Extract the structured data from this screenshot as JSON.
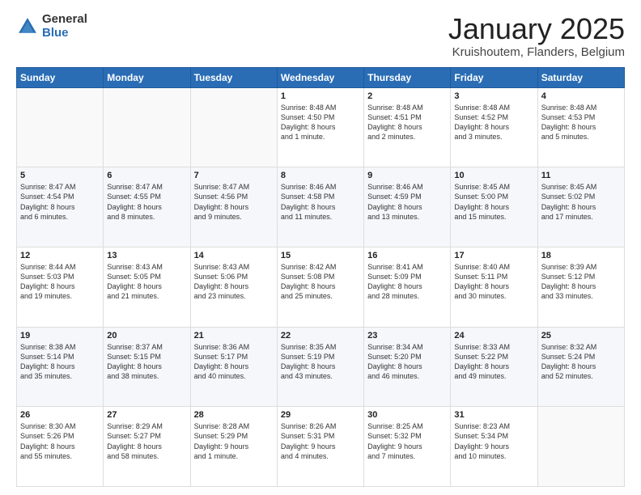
{
  "logo": {
    "general": "General",
    "blue": "Blue"
  },
  "title": {
    "month": "January 2025",
    "location": "Kruishoutem, Flanders, Belgium"
  },
  "weekdays": [
    "Sunday",
    "Monday",
    "Tuesday",
    "Wednesday",
    "Thursday",
    "Friday",
    "Saturday"
  ],
  "weeks": [
    [
      {
        "day": "",
        "info": ""
      },
      {
        "day": "",
        "info": ""
      },
      {
        "day": "",
        "info": ""
      },
      {
        "day": "1",
        "info": "Sunrise: 8:48 AM\nSunset: 4:50 PM\nDaylight: 8 hours\nand 1 minute."
      },
      {
        "day": "2",
        "info": "Sunrise: 8:48 AM\nSunset: 4:51 PM\nDaylight: 8 hours\nand 2 minutes."
      },
      {
        "day": "3",
        "info": "Sunrise: 8:48 AM\nSunset: 4:52 PM\nDaylight: 8 hours\nand 3 minutes."
      },
      {
        "day": "4",
        "info": "Sunrise: 8:48 AM\nSunset: 4:53 PM\nDaylight: 8 hours\nand 5 minutes."
      }
    ],
    [
      {
        "day": "5",
        "info": "Sunrise: 8:47 AM\nSunset: 4:54 PM\nDaylight: 8 hours\nand 6 minutes."
      },
      {
        "day": "6",
        "info": "Sunrise: 8:47 AM\nSunset: 4:55 PM\nDaylight: 8 hours\nand 8 minutes."
      },
      {
        "day": "7",
        "info": "Sunrise: 8:47 AM\nSunset: 4:56 PM\nDaylight: 8 hours\nand 9 minutes."
      },
      {
        "day": "8",
        "info": "Sunrise: 8:46 AM\nSunset: 4:58 PM\nDaylight: 8 hours\nand 11 minutes."
      },
      {
        "day": "9",
        "info": "Sunrise: 8:46 AM\nSunset: 4:59 PM\nDaylight: 8 hours\nand 13 minutes."
      },
      {
        "day": "10",
        "info": "Sunrise: 8:45 AM\nSunset: 5:00 PM\nDaylight: 8 hours\nand 15 minutes."
      },
      {
        "day": "11",
        "info": "Sunrise: 8:45 AM\nSunset: 5:02 PM\nDaylight: 8 hours\nand 17 minutes."
      }
    ],
    [
      {
        "day": "12",
        "info": "Sunrise: 8:44 AM\nSunset: 5:03 PM\nDaylight: 8 hours\nand 19 minutes."
      },
      {
        "day": "13",
        "info": "Sunrise: 8:43 AM\nSunset: 5:05 PM\nDaylight: 8 hours\nand 21 minutes."
      },
      {
        "day": "14",
        "info": "Sunrise: 8:43 AM\nSunset: 5:06 PM\nDaylight: 8 hours\nand 23 minutes."
      },
      {
        "day": "15",
        "info": "Sunrise: 8:42 AM\nSunset: 5:08 PM\nDaylight: 8 hours\nand 25 minutes."
      },
      {
        "day": "16",
        "info": "Sunrise: 8:41 AM\nSunset: 5:09 PM\nDaylight: 8 hours\nand 28 minutes."
      },
      {
        "day": "17",
        "info": "Sunrise: 8:40 AM\nSunset: 5:11 PM\nDaylight: 8 hours\nand 30 minutes."
      },
      {
        "day": "18",
        "info": "Sunrise: 8:39 AM\nSunset: 5:12 PM\nDaylight: 8 hours\nand 33 minutes."
      }
    ],
    [
      {
        "day": "19",
        "info": "Sunrise: 8:38 AM\nSunset: 5:14 PM\nDaylight: 8 hours\nand 35 minutes."
      },
      {
        "day": "20",
        "info": "Sunrise: 8:37 AM\nSunset: 5:15 PM\nDaylight: 8 hours\nand 38 minutes."
      },
      {
        "day": "21",
        "info": "Sunrise: 8:36 AM\nSunset: 5:17 PM\nDaylight: 8 hours\nand 40 minutes."
      },
      {
        "day": "22",
        "info": "Sunrise: 8:35 AM\nSunset: 5:19 PM\nDaylight: 8 hours\nand 43 minutes."
      },
      {
        "day": "23",
        "info": "Sunrise: 8:34 AM\nSunset: 5:20 PM\nDaylight: 8 hours\nand 46 minutes."
      },
      {
        "day": "24",
        "info": "Sunrise: 8:33 AM\nSunset: 5:22 PM\nDaylight: 8 hours\nand 49 minutes."
      },
      {
        "day": "25",
        "info": "Sunrise: 8:32 AM\nSunset: 5:24 PM\nDaylight: 8 hours\nand 52 minutes."
      }
    ],
    [
      {
        "day": "26",
        "info": "Sunrise: 8:30 AM\nSunset: 5:26 PM\nDaylight: 8 hours\nand 55 minutes."
      },
      {
        "day": "27",
        "info": "Sunrise: 8:29 AM\nSunset: 5:27 PM\nDaylight: 8 hours\nand 58 minutes."
      },
      {
        "day": "28",
        "info": "Sunrise: 8:28 AM\nSunset: 5:29 PM\nDaylight: 9 hours\nand 1 minute."
      },
      {
        "day": "29",
        "info": "Sunrise: 8:26 AM\nSunset: 5:31 PM\nDaylight: 9 hours\nand 4 minutes."
      },
      {
        "day": "30",
        "info": "Sunrise: 8:25 AM\nSunset: 5:32 PM\nDaylight: 9 hours\nand 7 minutes."
      },
      {
        "day": "31",
        "info": "Sunrise: 8:23 AM\nSunset: 5:34 PM\nDaylight: 9 hours\nand 10 minutes."
      },
      {
        "day": "",
        "info": ""
      }
    ]
  ]
}
